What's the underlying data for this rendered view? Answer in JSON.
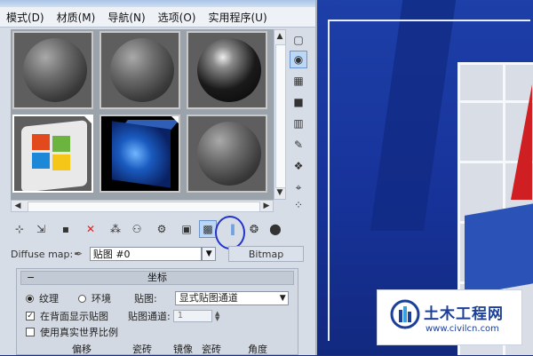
{
  "menubar": {
    "items": [
      {
        "label": "模式(D)"
      },
      {
        "label": "材质(M)"
      },
      {
        "label": "导航(N)"
      },
      {
        "label": "选项(O)"
      },
      {
        "label": "实用程序(U)"
      }
    ]
  },
  "sample_slots": [
    {
      "kind": "sphere"
    },
    {
      "kind": "sphere"
    },
    {
      "kind": "dark-sphere"
    },
    {
      "kind": "windows-box"
    },
    {
      "kind": "blue-cube"
    },
    {
      "kind": "sphere"
    }
  ],
  "side_toolbar": {
    "icons": [
      "box-icon",
      "sample-type-icon",
      "checker-background-icon",
      "sample-uv-icon",
      "video-check-icon",
      "make-preview-icon",
      "options-icon",
      "select-by-material-icon",
      "material-navigator-icon"
    ]
  },
  "toolbar": {
    "icons": [
      "get-material-icon",
      "put-to-scene-icon",
      "assign-material-icon",
      "reset-map-icon",
      "make-unique-icon",
      "put-to-library-icon",
      "material-id-icon",
      "show-in-viewport-icon",
      "show-end-result-icon",
      "go-to-parent-icon",
      "go-forward-icon"
    ]
  },
  "map_row": {
    "label": "Diffuse map:",
    "map_name": "贴图 #0",
    "map_type": "Bitmap"
  },
  "coords": {
    "title": "坐标",
    "texture_label": "纹理",
    "environ_label": "环境",
    "mapping_label": "贴图:",
    "mapping_value": "显式贴图通道",
    "show_back_label": "在背面显示贴图",
    "channel_label": "贴图通道:",
    "channel_value": "1",
    "real_world_label": "使用真实世界比例",
    "col_offset": "偏移",
    "col_tiling": "瓷砖",
    "col_mirror": "镜像",
    "col_tile": "瓷砖",
    "col_angle": "角度"
  },
  "watermark": {
    "brand": "土木工程网",
    "url": "www.civilcn.com"
  },
  "colors": {
    "viewport_bg": "#1d3fa8",
    "panel_bg": "#d7dde6",
    "annotation_circle": "#2233cc",
    "brand_blue": "#1c3f9a"
  }
}
